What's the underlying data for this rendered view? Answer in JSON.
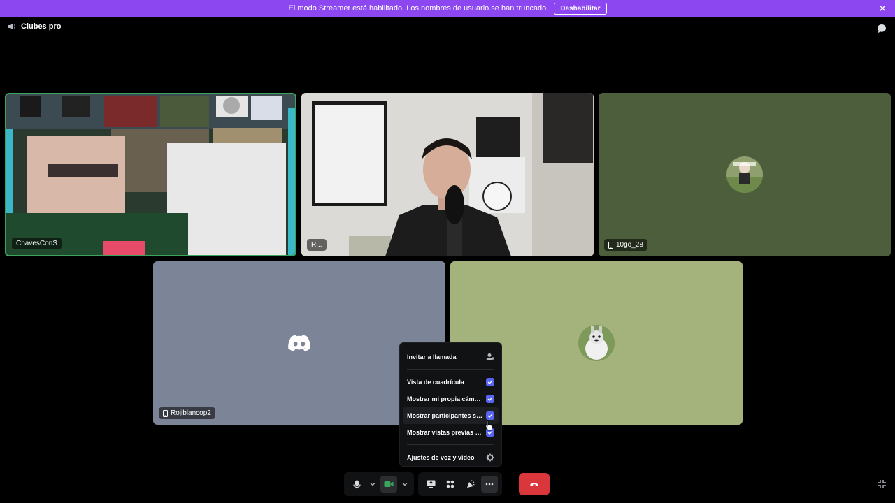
{
  "banner": {
    "message": "El modo Streamer está habilitado. Los nombres de usuario se han truncado.",
    "disable_label": "Deshabilitar"
  },
  "header": {
    "channel_name": "Clubes pro"
  },
  "tiles": [
    {
      "name": "ChavesConS",
      "speaking": true
    },
    {
      "name": "R..."
    },
    {
      "name": "10go_28",
      "mobile": true
    },
    {
      "name": "Rojiblancop2",
      "mobile": true
    },
    {
      "name": ""
    }
  ],
  "menu": {
    "invite": "Invitar a llamada",
    "grid_view": "Vista de cuadrícula",
    "show_own_camera": "Mostrar mi propia cámara",
    "show_participants": "Mostrar participantes sin vídeo",
    "show_previews": "Mostrar vistas previas de las transmisiones",
    "settings": "Ajustes de voz y vídeo"
  },
  "colors": {
    "accent": "#5865f2",
    "banner": "#8c47f0",
    "hangup": "#da373c",
    "speaking": "#3ba55d"
  }
}
